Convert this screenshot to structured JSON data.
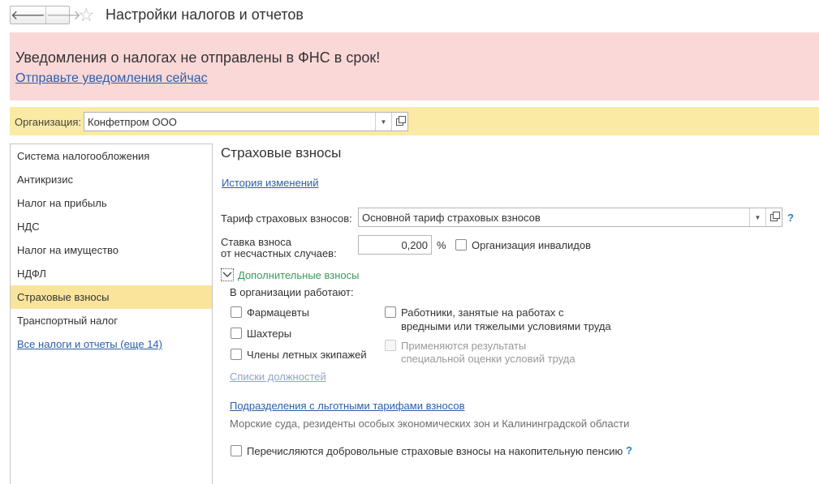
{
  "window": {
    "title": "Настройки налогов и отчетов"
  },
  "banner": {
    "message": "Уведомления о налогах не отправлены в ФНС в срок!",
    "link": "Отправьте уведомления сейчас"
  },
  "organization": {
    "label": "Организация:",
    "value": "Конфетпром ООО"
  },
  "sidebar": {
    "active_index": 6,
    "items": [
      "Система налогообложения",
      "Антикризис",
      "Налог на прибыль",
      "НДС",
      "Налог на имущество",
      "НДФЛ",
      "Страховые взносы",
      "Транспортный налог"
    ],
    "all_link": "Все налоги и отчеты (еще 14)"
  },
  "section": {
    "title": "Страховые взносы",
    "history_link": "История изменений",
    "tariff": {
      "label": "Тариф страховых взносов:",
      "value": "Основной тариф страховых взносов",
      "help": "?"
    },
    "accident_rate": {
      "label_line1": "Ставка взноса",
      "label_line2": "от несчастных случаев:",
      "value": "0,200",
      "unit": "%"
    },
    "disabled_org": {
      "label": "Организация инвалидов",
      "checked": false
    },
    "additional": {
      "title": "Дополнительные взносы",
      "expanded": true,
      "workers_label": "В организации работают:",
      "pharmacists": "Фармацевты",
      "miners": "Шахтеры",
      "flight_crew": "Члены летных экипажей",
      "hazard_line1": "Работники, занятые на работах с",
      "hazard_line2": "вредными или тяжелыми условиями труда",
      "assessment_line1": "Применяются результаты",
      "assessment_line2": "специальной оценки условий труда",
      "positions_link": "Списки должностей"
    },
    "divisions": {
      "link": "Подразделения с льготными тарифами взносов",
      "description": "Морские суда, резиденты особых экономических зон и Калининградской области"
    },
    "voluntary": {
      "label": "Перечисляются добровольные страховые взносы на накопительную пенсию",
      "help": "?"
    }
  },
  "colors": {
    "banner_bg": "#fbd8d8",
    "org_bar_bg": "#faeaa4",
    "active_item_bg": "#fae49c",
    "link": "#2a5fa8",
    "group_title": "#3b9a5a",
    "help": "#2a7fc0"
  },
  "icons": [
    "arrow-left-icon",
    "arrow-right-icon",
    "star-icon",
    "chevron-down-icon",
    "open-form-icon",
    "help-icon",
    "checkbox-icon"
  ]
}
